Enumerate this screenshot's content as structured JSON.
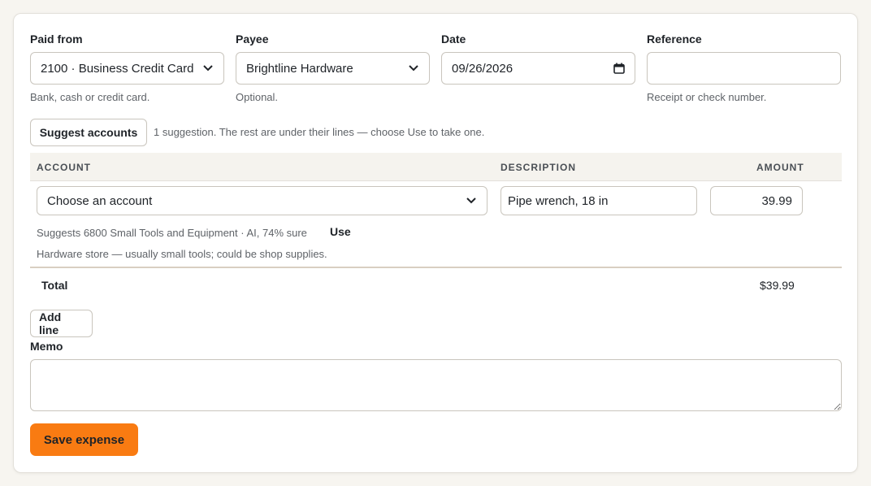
{
  "header": {
    "paid_from": {
      "label": "Paid from",
      "value": "2100 · Business Credit Card",
      "hint": "Bank, cash or credit card."
    },
    "payee": {
      "label": "Payee",
      "value": "Brightline Hardware",
      "hint": "Optional."
    },
    "date": {
      "label": "Date",
      "value": "09/26/2026"
    },
    "reference": {
      "label": "Reference",
      "value": "",
      "hint": "Receipt or check number."
    }
  },
  "suggest": {
    "button_label": "Suggest accounts",
    "status": "1 suggestion. The rest are under their lines — choose Use to take one."
  },
  "lines": {
    "columns": [
      "ACCOUNT",
      "DESCRIPTION",
      "AMOUNT"
    ],
    "rows": [
      {
        "account_placeholder": "Choose an account",
        "description": "Pipe wrench, 18 in",
        "amount": "39.99",
        "suggestion": "Suggests 6800 Small Tools and Equipment · AI, 74% sure",
        "use_label": "Use",
        "reason": "Hardware store — usually small tools; could be shop supplies."
      }
    ],
    "total_label": "Total",
    "total_value": "$39.99",
    "add_line_label": "Add line"
  },
  "memo": {
    "label": "Memo",
    "value": ""
  },
  "save_label": "Save expense",
  "colors": {
    "accent": "#f97b12",
    "background": "#f7f5f0",
    "card": "#ffffff"
  },
  "icons": {
    "select": "chevron-down-icon",
    "date": "calendar-icon"
  }
}
